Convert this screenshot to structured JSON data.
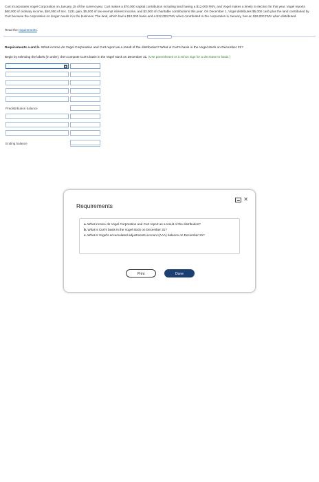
{
  "problem": {
    "text": "Curt incorporates Vogel Corporation on January 15 of the current year. Curt makes a $70,000 capital contribution including land having a $12,000 FMV, and Vogel makes a timely S election for this year. Vogel reports $60,000 of ordinary income, $40,000 of Sec. 1231 gain, $5,000 of tax-exempt interest income, and $3,000 of charitable contributions this year. On December 1, Vogel distributes $5,000 cash plus the land contributed by Curt because the corporation no longer needs it in the business. The land, which had a $10,000 basis and a $12,000 FMV when contributed to the corporation in January, has an $18,000 FMV when distributed.",
    "read_prefix": "Read the ",
    "read_link": "requirements",
    "read_suffix": "."
  },
  "question": {
    "req_bold": "Requirements a and b.",
    "req_text": " What income do Vogel Corporation and Curt report as a result of the distribution? What is Curt's basis in the Vogel stock on December 31?",
    "begin_text": "Begin by selecting the labels (in order), then compute Curt's basis in the Vogel stock on December 31. ",
    "hint": "(Use parentheses or a minus sign for a decrease to basis.)"
  },
  "rows": {
    "predistribution_label": "Predistribution balance",
    "ending_label": "Ending balance"
  },
  "dialog": {
    "title": "Requirements",
    "items": [
      {
        "letter": "a.",
        "text": " What income do Vogel Corporation and Curt report as a result of the distribution?"
      },
      {
        "letter": "b.",
        "text": " What is Curt's basis in the Vogel stock on December 31?"
      },
      {
        "letter": "c.",
        "text": " What is Vogel's accumulated adjustments account (AAA) balance on December 31?"
      }
    ],
    "print_label": "Print",
    "done_label": "Done",
    "minmax_glyph": "▬",
    "close_glyph": "✕"
  },
  "icons": {
    "dropdown": "▾"
  },
  "colors": {
    "accent": "#2a6ebb",
    "link": "#1f5ea8",
    "hint_green": "#2e8b2e",
    "done_button": "#1c3f73"
  }
}
